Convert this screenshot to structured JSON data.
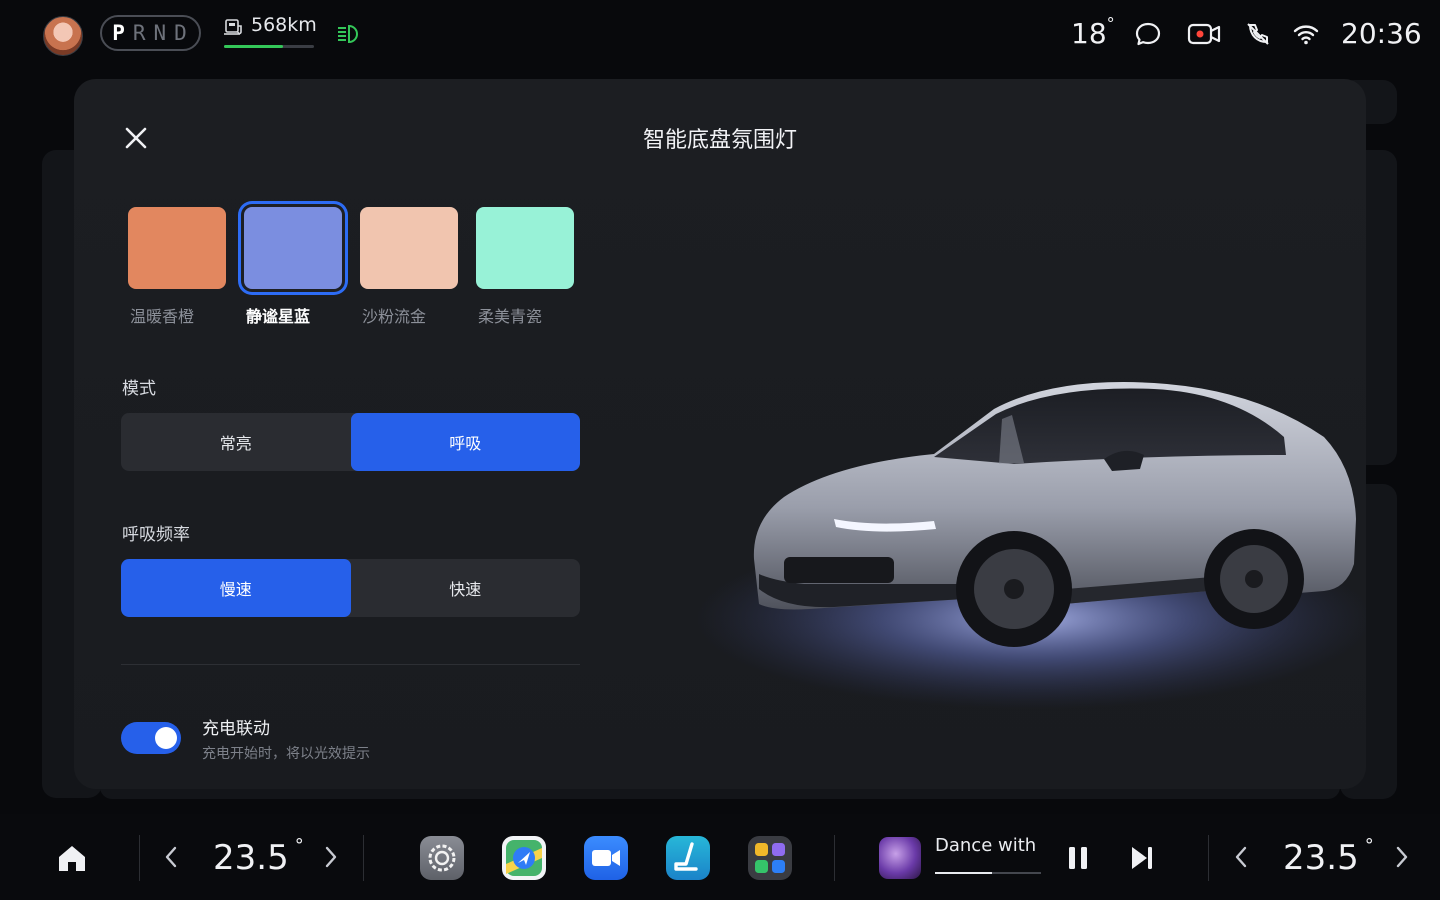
{
  "status": {
    "gears": [
      "P",
      "R",
      "N",
      "D"
    ],
    "active_gear": "P",
    "range": "568km",
    "range_level": 0.65,
    "outside_temp": "18",
    "degree": "°",
    "time": "20:36",
    "icons": [
      "headlight-icon",
      "message-icon",
      "camera-record-icon",
      "phone-link-icon",
      "wifi-icon"
    ]
  },
  "modal": {
    "title": "智能底盘氛围灯",
    "colors": [
      {
        "label": "温暖香橙",
        "hex": "#e2875f"
      },
      {
        "label": "静谧星蓝",
        "hex": "#7b8ee0"
      },
      {
        "label": "沙粉流金",
        "hex": "#f1c5af"
      },
      {
        "label": "柔美青瓷",
        "hex": "#98f2d7"
      }
    ],
    "selected_color": "静谧星蓝",
    "mode": {
      "label": "模式",
      "options": [
        "常亮",
        "呼吸"
      ],
      "selected": "呼吸"
    },
    "breath_rate": {
      "label": "呼吸频率",
      "options": [
        "慢速",
        "快速"
      ],
      "selected": "慢速"
    },
    "charge_link": {
      "title": "充电联动",
      "description": "充电开始时，将以光效提示",
      "enabled": true
    }
  },
  "dock": {
    "left_temp": "23.5",
    "right_temp": "23.5",
    "degree": "°",
    "apps": [
      "settings-app-icon",
      "navigation-app-icon",
      "video-call-app-icon",
      "seat-app-icon",
      "app-grid-icon"
    ],
    "music": {
      "title": "Dance with",
      "progress": 0.54
    }
  }
}
